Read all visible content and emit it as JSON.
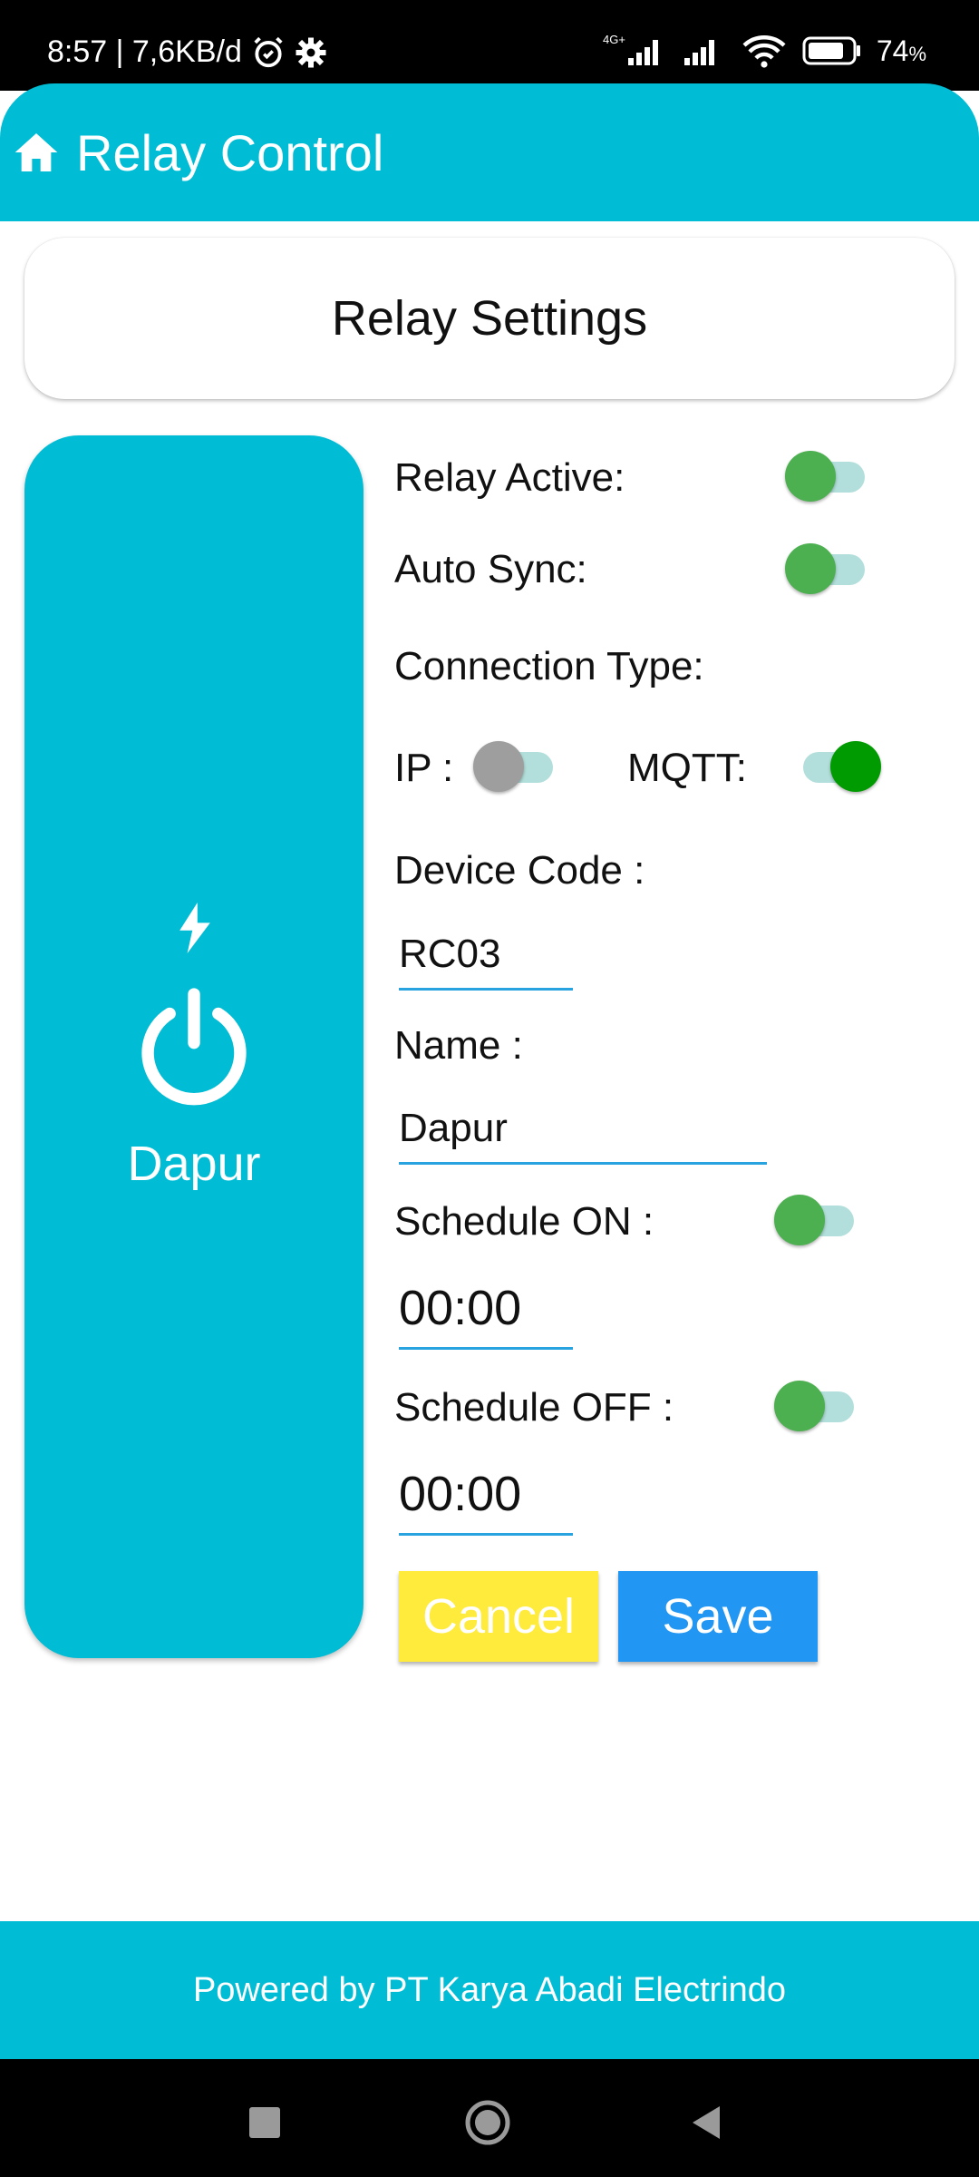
{
  "status_bar": {
    "time_speed": "8:57 | 7,6KB/d",
    "network_label": "4G+",
    "battery": "74",
    "battery_unit": "%",
    "icons": [
      "alarm-icon",
      "settings-icon",
      "signal-icon",
      "wifi-icon",
      "battery-icon"
    ]
  },
  "app_bar": {
    "title": "Relay Control",
    "icon": "home-icon"
  },
  "header_card": {
    "title": "Relay Settings"
  },
  "relay_panel": {
    "name": "Dapur",
    "icons": [
      "bolt-icon",
      "power-icon"
    ]
  },
  "form": {
    "relay_active_label": "Relay Active:",
    "relay_active_state": "off",
    "auto_sync_label": "Auto Sync:",
    "auto_sync_state": "off",
    "connection_type_label": "Connection Type:",
    "ip_label": "IP :",
    "ip_state": "off",
    "mqtt_label": "MQTT:",
    "mqtt_state": "on",
    "device_code_label": "Device Code :",
    "device_code_value": "RC03",
    "name_label": "Name :",
    "name_value": "Dapur",
    "schedule_on_label": "Schedule ON :",
    "schedule_on_state": "off",
    "schedule_on_time": "00:00",
    "schedule_off_label": "Schedule OFF :",
    "schedule_off_state": "off",
    "schedule_off_time": "00:00"
  },
  "buttons": {
    "cancel": "Cancel",
    "save": "Save"
  },
  "footer": {
    "text": "Powered by PT Karya Abadi Electrindo"
  },
  "colors": {
    "primary": "#00BCD4",
    "toggle_thumb": "#4CAF50",
    "toggle_thumb_active": "#009B00",
    "toggle_track": "#B2DFDB",
    "cancel_button": "#FFEB3B",
    "save_button": "#2196F3"
  }
}
